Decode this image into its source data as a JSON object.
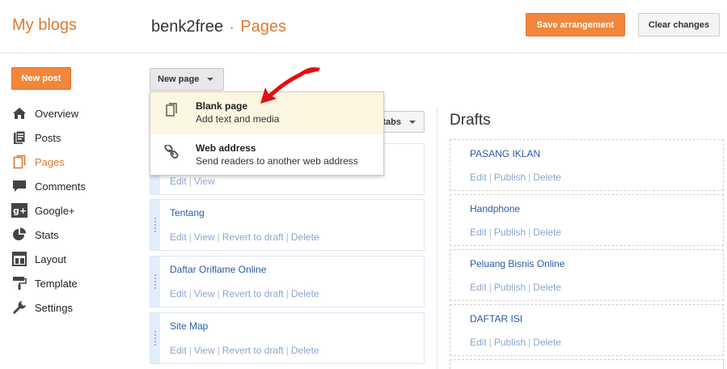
{
  "header": {
    "brand": "My blogs",
    "blog_name": "benk2free",
    "separator": "·",
    "section": "Pages",
    "save_label": "Save arrangement",
    "clear_label": "Clear changes"
  },
  "sidebar": {
    "new_post_label": "New post",
    "items": [
      {
        "label": "Overview",
        "icon": "home-icon"
      },
      {
        "label": "Posts",
        "icon": "posts-icon"
      },
      {
        "label": "Pages",
        "icon": "pages-icon",
        "active": true
      },
      {
        "label": "Comments",
        "icon": "comment-icon"
      },
      {
        "label": "Google+",
        "icon": "google-plus-icon"
      },
      {
        "label": "Stats",
        "icon": "pie-chart-icon"
      },
      {
        "label": "Layout",
        "icon": "layout-icon"
      },
      {
        "label": "Template",
        "icon": "paint-roller-icon"
      },
      {
        "label": "Settings",
        "icon": "wrench-icon"
      }
    ]
  },
  "toolbar": {
    "new_page_label": "New page",
    "tabs_label": "tabs"
  },
  "dropdown": {
    "items": [
      {
        "title": "Blank page",
        "desc": "Add text and media",
        "icon": "blank-page-icon"
      },
      {
        "title": "Web address",
        "desc": "Send readers to another web address",
        "icon": "link-icon"
      }
    ]
  },
  "pages": {
    "first_actions": {
      "edit": "Edit",
      "view": "View"
    },
    "items": [
      {
        "title": "Tentang",
        "edit": "Edit",
        "view": "View",
        "revert": "Revert to draft",
        "delete": "Delete"
      },
      {
        "title": "Daftar Oriflame Online",
        "edit": "Edit",
        "view": "View",
        "revert": "Revert to draft",
        "delete": "Delete"
      },
      {
        "title": "Site Map",
        "edit": "Edit",
        "view": "View",
        "revert": "Revert to draft",
        "delete": "Delete"
      }
    ]
  },
  "drafts": {
    "heading": "Drafts",
    "items": [
      {
        "title": "PASANG IKLAN",
        "edit": "Edit",
        "publish": "Publish",
        "delete": "Delete"
      },
      {
        "title": "Handphone",
        "edit": "Edit",
        "publish": "Publish",
        "delete": "Delete"
      },
      {
        "title": "Peluang Bisnis Online",
        "edit": "Edit",
        "publish": "Publish",
        "delete": "Delete"
      },
      {
        "title": "DAFTAR ISI",
        "edit": "Edit",
        "publish": "Publish",
        "delete": "Delete"
      }
    ]
  },
  "colors": {
    "accent": "#dd7a2f",
    "link": "#2a5aa7",
    "annotation_arrow": "#e01010"
  }
}
